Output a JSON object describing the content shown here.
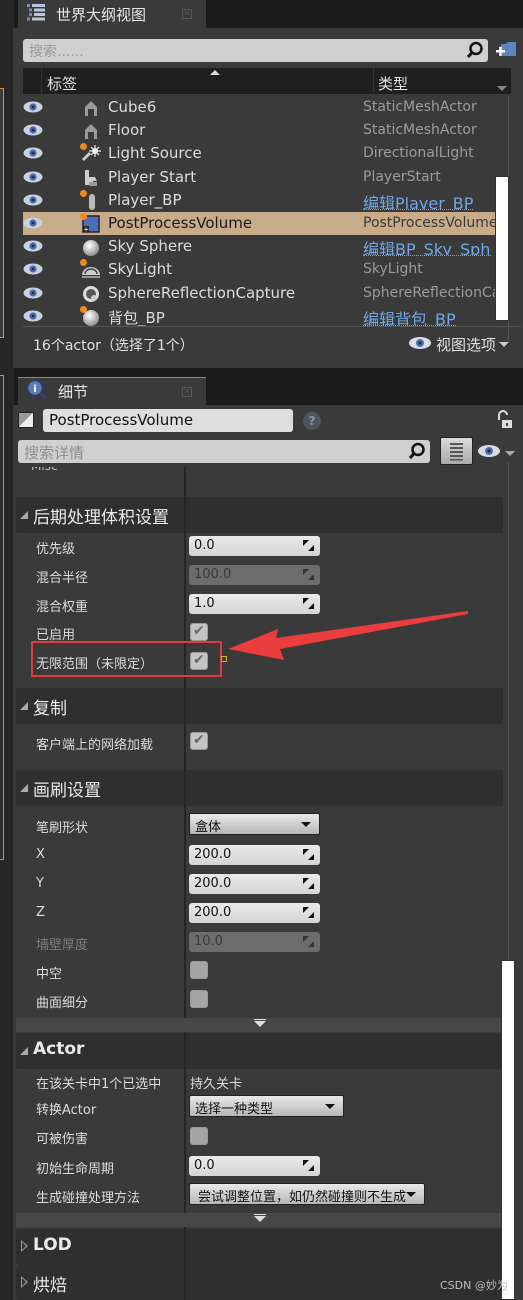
{
  "outliner": {
    "tab_title": "世界大纲视图",
    "tab_icon": "list-icon",
    "search_placeholder": "搜索......",
    "columns": {
      "label": "标签",
      "type": "类型"
    },
    "actors": [
      {
        "name": "Cube6",
        "type": "StaticMeshActor",
        "icon": "static-mesh-icon",
        "type_is_link": false,
        "selected": false
      },
      {
        "name": "Floor",
        "type": "StaticMeshActor",
        "icon": "static-mesh-icon",
        "type_is_link": false,
        "selected": false
      },
      {
        "name": "Light Source",
        "type": "DirectionalLight",
        "icon": "directional-light-icon",
        "type_is_link": false,
        "selected": false
      },
      {
        "name": "Player Start",
        "type": "PlayerStart",
        "icon": "player-start-icon",
        "type_is_link": false,
        "selected": false
      },
      {
        "name": "Player_BP",
        "type": "编辑Player_BP",
        "icon": "pawn-icon",
        "type_is_link": true,
        "selected": false
      },
      {
        "name": "PostProcessVolume",
        "type": "PostProcessVolume",
        "icon": "post-process-volume-icon",
        "type_is_link": false,
        "selected": true
      },
      {
        "name": "Sky Sphere",
        "type": "编辑BP_Sky_Sphere",
        "icon": "sphere-icon",
        "type_is_link": true,
        "selected": false
      },
      {
        "name": "SkyLight",
        "type": "SkyLight",
        "icon": "sky-light-icon",
        "type_is_link": false,
        "selected": false
      },
      {
        "name": "SphereReflectionCapture",
        "type": "SphereReflectionCapture",
        "icon": "reflection-capture-icon",
        "type_is_link": false,
        "selected": false
      },
      {
        "name": "背包_BP",
        "type": "编辑背包_BP",
        "icon": "sphere-icon",
        "type_is_link": true,
        "selected": false
      }
    ],
    "footer_count": "16个actor（选择了1个）",
    "view_options": "视图选项"
  },
  "details": {
    "tab_title": "细节",
    "object_name": "PostProcessVolume",
    "search_placeholder": "搜索详情",
    "misc_stub": "Misc",
    "categories": {
      "post_process": {
        "title": "后期处理体积设置",
        "priority": {
          "label": "优先级",
          "value": "0.0"
        },
        "blend_radius": {
          "label": "混合半径",
          "value": "100.0"
        },
        "blend_weight": {
          "label": "混合权重",
          "value": "1.0"
        },
        "enabled": {
          "label": "已启用",
          "checked": true
        },
        "unbound": {
          "label": "无限范围（未限定）",
          "checked": true
        }
      },
      "replication": {
        "title": "复制",
        "net_load_on_client": {
          "label": "客户端上的网络加载",
          "checked": true
        }
      },
      "brush": {
        "title": "画刷设置",
        "shape": {
          "label": "笔刷形状",
          "value": "盒体"
        },
        "x": {
          "label": "X",
          "value": "200.0"
        },
        "y": {
          "label": "Y",
          "value": "200.0"
        },
        "z": {
          "label": "Z",
          "value": "200.0"
        },
        "wall_thickness": {
          "label": "墙壁厚度",
          "value": "10.0"
        },
        "hollow": {
          "label": "中空",
          "checked": false
        },
        "tessellated": {
          "label": "曲面细分",
          "checked": false
        }
      },
      "actor": {
        "title": "Actor",
        "selected_in_level": {
          "label": "在该关卡中1个已选中",
          "value": "持久关卡"
        },
        "convert_actor": {
          "label": "转换Actor",
          "value": "选择一种类型"
        },
        "can_be_damaged": {
          "label": "可被伤害",
          "checked": false
        },
        "initial_life_span": {
          "label": "初始生命周期",
          "value": "0.0"
        },
        "spawn_collision": {
          "label": "生成碰撞处理方法",
          "value": "尝试调整位置，如仍然碰撞则不生成"
        }
      },
      "lod": {
        "title": "LOD"
      },
      "baking": {
        "title": "烘焙"
      }
    }
  },
  "annotation": {
    "highlight_color": "#e23a3a"
  },
  "watermark": "CSDN @妙为"
}
